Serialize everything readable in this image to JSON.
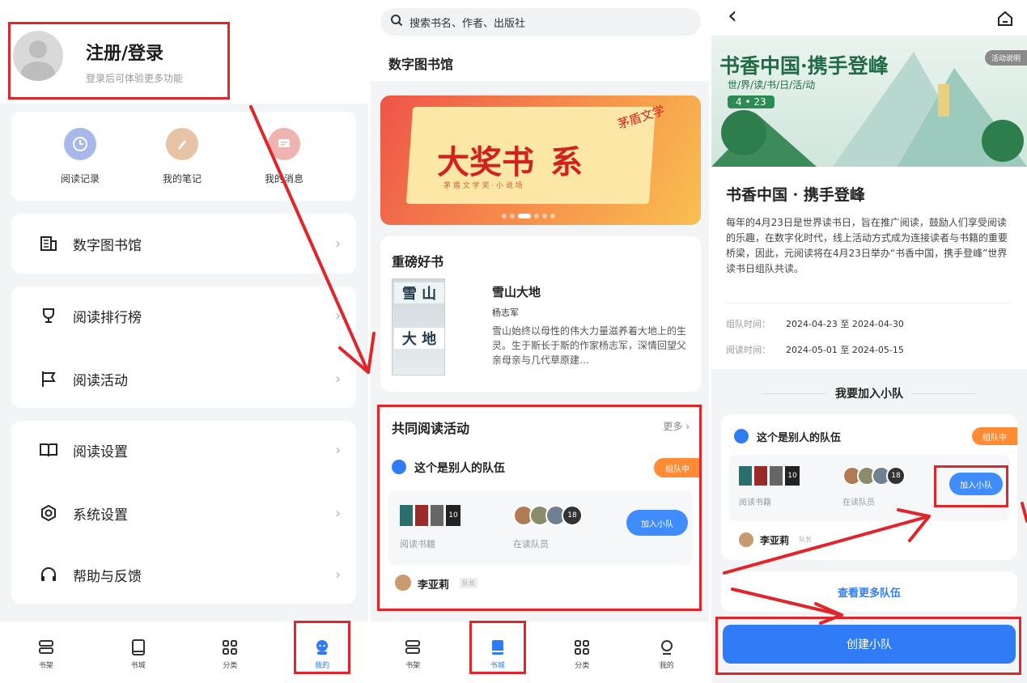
{
  "profile": {
    "title": "注册/登录",
    "subtitle": "登录后可体验更多功能"
  },
  "quick_actions": [
    {
      "label": "阅读记录",
      "icon": "clock-icon",
      "color": "#a9b8ea"
    },
    {
      "label": "我的笔记",
      "icon": "pen-icon",
      "color": "#e6c3a4"
    },
    {
      "label": "我的消息",
      "icon": "message-icon",
      "color": "#f0b4b0"
    }
  ],
  "menu": {
    "library": "数字图书馆",
    "ranking": "阅读排行榜",
    "activity": "阅读活动",
    "reading_settings": "阅读设置",
    "system_settings": "系统设置",
    "help": "帮助与反馈",
    "chevron": "›"
  },
  "tabs": [
    {
      "label": "书架",
      "icon": "bookshelf-icon"
    },
    {
      "label": "书城",
      "icon": "book-icon"
    },
    {
      "label": "分类",
      "icon": "grid-icon"
    },
    {
      "label": "我的",
      "icon": "user-icon"
    }
  ],
  "library": {
    "search_placeholder": "搜索书名、作者、出版社",
    "title": "数字图书馆",
    "banner_title": "大奖书",
    "banner_title2": "系",
    "banner_sub": "茅 盾 文 学 奖 · 小 说 场",
    "banner_side": "茅盾文学",
    "featured": {
      "heading": "重磅好书",
      "book_title": "雪山大地",
      "author": "杨志军",
      "desc": "雪山始终以母性的伟大力量滋养着大地上的生灵。生于斯长于斯的作家杨志军，深情回望父亲母亲与几代草原建…",
      "cover_text1": "雪 山",
      "cover_text2": "大 地"
    },
    "coread": {
      "heading": "共同阅读活动",
      "more": "更多 ›",
      "team_name": "这个是别人的队伍",
      "badge": "组队中",
      "books_label": "阅读书籍",
      "members_label": "在读队员",
      "join": "加入小队",
      "leader": "李亚莉",
      "leader_tag": "队长",
      "book_count": "10",
      "member_count": "18"
    }
  },
  "event": {
    "back": "‹",
    "banner_title": "书香中国·携手登峰",
    "banner_sub": "世/界/读/书/日/活/动",
    "banner_date": "4 • 23",
    "rules": "活动说明",
    "title": "书香中国 · 携手登峰",
    "desc": "每年的4月23日是世界读书日，旨在推广阅读，鼓励人们享受阅读的乐趣，在数字化时代，线上活动方式成为连接读者与书籍的重要桥梁，因此，元阅读将在4月23日举办“书香中国，携手登峰”世界读书日组队共读。",
    "team_time_label": "组队时间：",
    "team_time": "2024-04-23 至 2024-04-30",
    "read_time_label": "阅读时间：",
    "read_time": "2024-05-01 至 2024-05-15",
    "join_heading": "我要加入小队",
    "team_name": "这个是别人的队伍",
    "badge": "组队中",
    "books_label": "阅读书籍",
    "members_label": "在读队员",
    "join": "加入小队",
    "leader": "李亚莉",
    "leader_tag": "队长",
    "more_teams": "查看更多队伍",
    "create": "创建小队",
    "book_count": "10",
    "member_count": "18"
  }
}
